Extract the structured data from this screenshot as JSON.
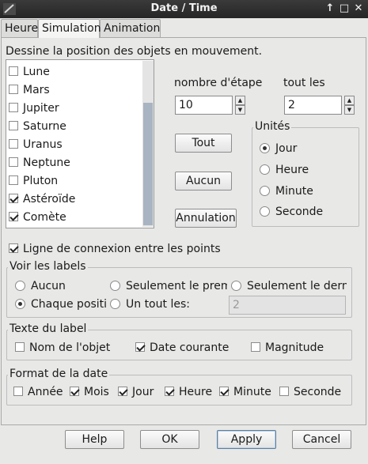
{
  "window": {
    "title": "Date / Time",
    "buttons": [
      "↑",
      "□",
      "✕"
    ]
  },
  "tabs": [
    "Heure",
    "Simulation",
    "Animation"
  ],
  "description": "Dessine la position des objets en mouvement.",
  "objects": [
    {
      "label": "Lune",
      "checked": false
    },
    {
      "label": "Mars",
      "checked": false
    },
    {
      "label": "Jupiter",
      "checked": false
    },
    {
      "label": "Saturne",
      "checked": false
    },
    {
      "label": "Uranus",
      "checked": false
    },
    {
      "label": "Neptune",
      "checked": false
    },
    {
      "label": "Pluton",
      "checked": false
    },
    {
      "label": "Astéroïde",
      "checked": true
    },
    {
      "label": "Comète",
      "checked": true
    }
  ],
  "steps": {
    "count_label": "nombre d'étape",
    "count_value": "10",
    "every_label": "tout les",
    "every_value": "2"
  },
  "actions": {
    "all": "Tout",
    "none": "Aucun",
    "cancel": "Annulation"
  },
  "units": {
    "title": "Unités",
    "options": [
      "Jour",
      "Heure",
      "Minute",
      "Seconde"
    ],
    "selected": "Jour"
  },
  "connect_line": {
    "label": "Ligne de connexion entre les points",
    "checked": true
  },
  "labels_group": {
    "title": "Voir les labels",
    "opt_none": "Aucun",
    "opt_first": "Seulement le premi",
    "opt_last": "Seulement le derni",
    "opt_each": "Chaque positio",
    "opt_every": "Un tout les:",
    "every_value": "2",
    "selected": "Chaque positio"
  },
  "label_text": {
    "title": "Texte du label",
    "object_name": "Nom de l'objet",
    "current_date": "Date courante",
    "magnitude": "Magnitude"
  },
  "date_format": {
    "title": "Format de la date",
    "year": "Année",
    "month": "Mois",
    "day": "Jour",
    "hour": "Heure",
    "minute": "Minute",
    "second": "Seconde"
  },
  "footer": {
    "help": "Help",
    "ok": "OK",
    "apply": "Apply",
    "cancel": "Cancel"
  }
}
